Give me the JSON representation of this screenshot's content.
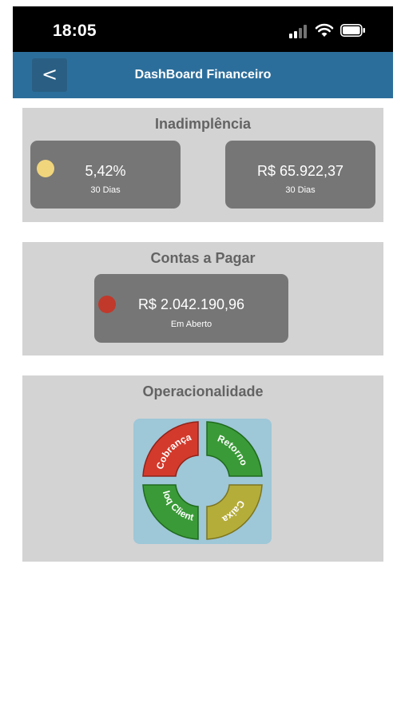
{
  "status_bar": {
    "time": "18:05",
    "icons": [
      "signal-icon",
      "wifi-icon",
      "battery-icon"
    ]
  },
  "nav": {
    "back_label": "<",
    "title": "DashBoard Financeiro",
    "color": "#2c6e9b"
  },
  "inadimplencia": {
    "title": "Inadimplência",
    "percent_card": {
      "value": "5,42%",
      "sub": "30 Dias",
      "indicator_color": "#f0d57c"
    },
    "amount_card": {
      "value": "R$ 65.922,37",
      "sub": "30 Dias"
    }
  },
  "contas_pagar": {
    "title": "Contas a Pagar",
    "card": {
      "value": "R$ 2.042.190,96",
      "sub": "Em Aberto",
      "indicator_color": "#c0392b"
    }
  },
  "operacionalidade": {
    "title": "Operacionalidade",
    "segments": [
      {
        "label": "Cobrança",
        "color": "#d33a2c"
      },
      {
        "label": "Retorno",
        "color": "#3a9a37"
      },
      {
        "label": "Caixa",
        "color": "#b5ad3a"
      },
      {
        "label": "Bloq Cliente",
        "color": "#3a9a37"
      }
    ]
  }
}
